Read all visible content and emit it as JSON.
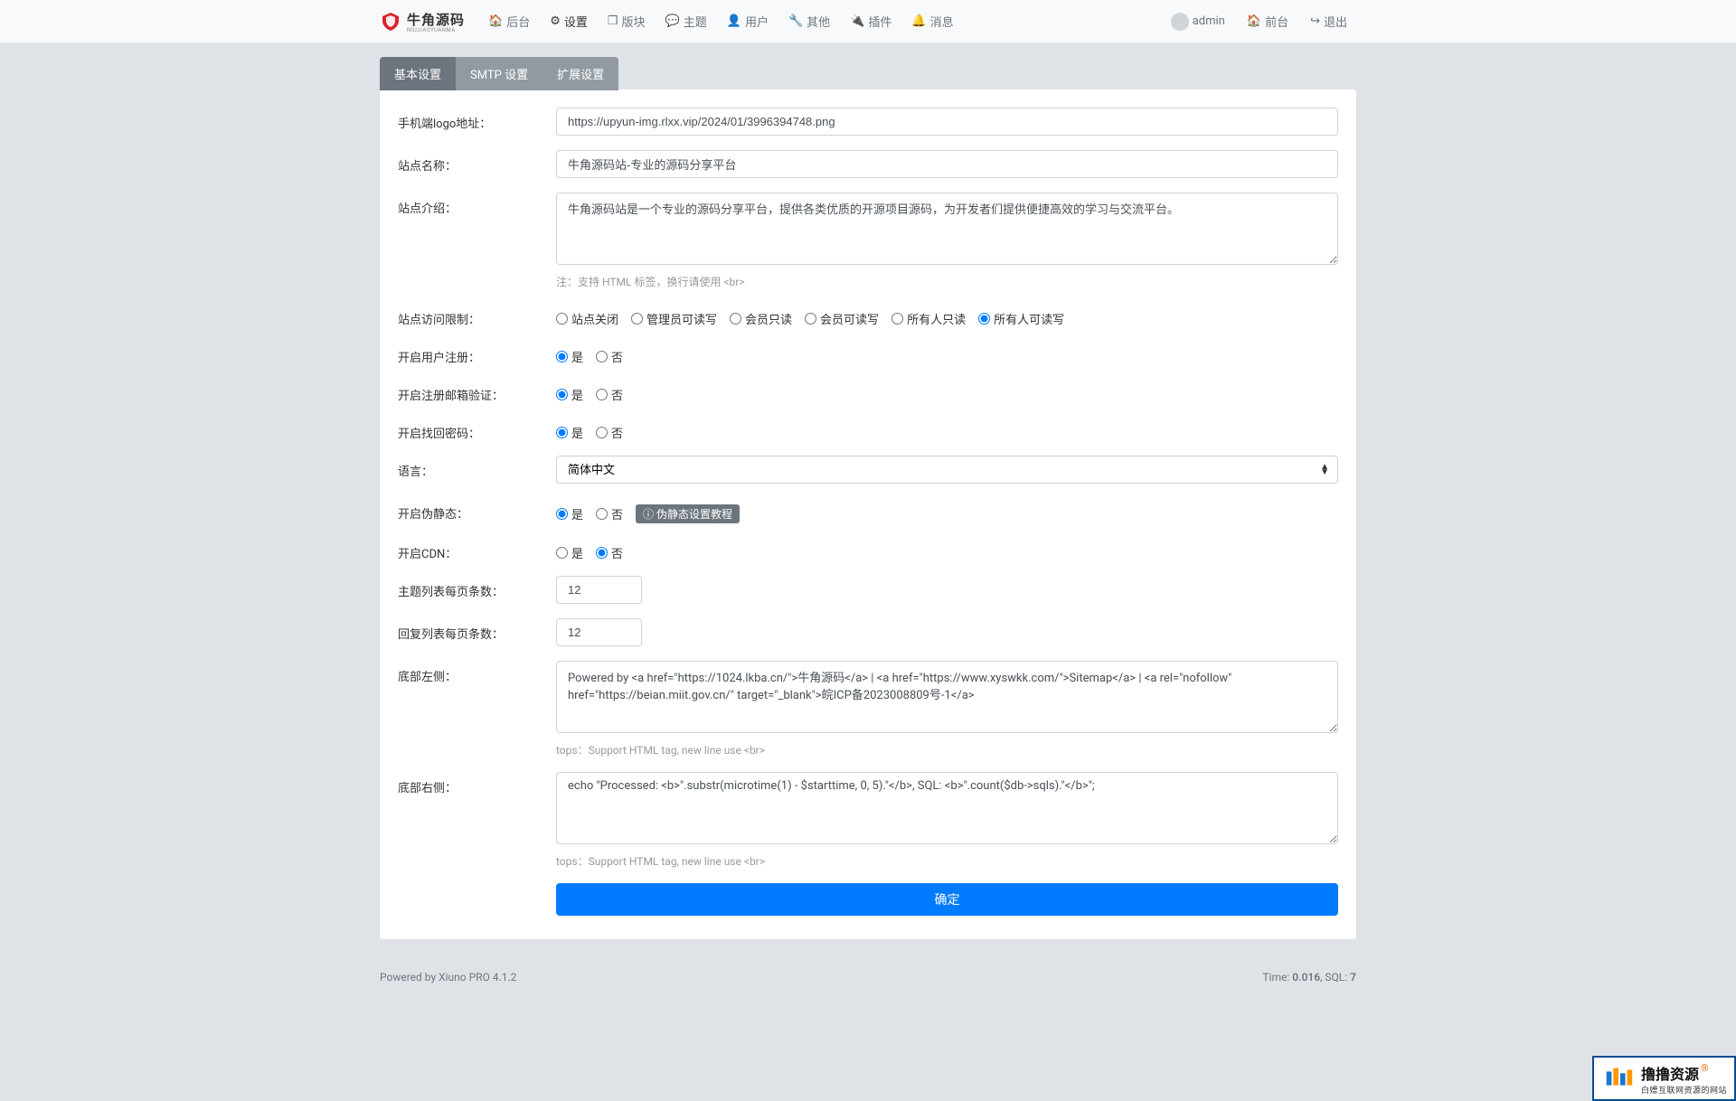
{
  "topbar": {
    "logo_text": "牛角源码",
    "logo_sub": "NIUJIAOYUANMA",
    "nav": [
      {
        "icon": "home",
        "label": "后台"
      },
      {
        "icon": "gear",
        "label": "设置"
      },
      {
        "icon": "cube",
        "label": "版块"
      },
      {
        "icon": "comment",
        "label": "主题"
      },
      {
        "icon": "user",
        "label": "用户"
      },
      {
        "icon": "wrench",
        "label": "其他"
      },
      {
        "icon": "plug",
        "label": "插件"
      },
      {
        "icon": "bell",
        "label": "消息"
      }
    ],
    "right": {
      "user": "admin",
      "frontend": "前台",
      "logout": "退出"
    }
  },
  "tabs": [
    {
      "label": "基本设置",
      "active": true
    },
    {
      "label": "SMTP 设置",
      "active": false
    },
    {
      "label": "扩展设置",
      "active": false
    }
  ],
  "form": {
    "mobile_logo": {
      "label": "手机端logo地址：",
      "value": "https://upyun-img.rlxx.vip/2024/01/3996394748.png"
    },
    "site_name": {
      "label": "站点名称：",
      "value": "牛角源码站-专业的源码分享平台"
    },
    "site_desc": {
      "label": "站点介绍：",
      "value": "牛角源码站是一个专业的源码分享平台，提供各类优质的开源项目源码，为开发者们提供便捷高效的学习与交流平台。",
      "note": "注：支持 HTML 标签，换行请使用 <br>"
    },
    "access": {
      "label": "站点访问限制：",
      "options": [
        "站点关闭",
        "管理员可读写",
        "会员只读",
        "会员可读写",
        "所有人只读",
        "所有人可读写"
      ],
      "selected": 5
    },
    "user_reg": {
      "label": "开启用户注册：",
      "options": [
        "是",
        "否"
      ],
      "selected": 0
    },
    "email_verify": {
      "label": "开启注册邮箱验证：",
      "options": [
        "是",
        "否"
      ],
      "selected": 0
    },
    "find_pwd": {
      "label": "开启找回密码：",
      "options": [
        "是",
        "否"
      ],
      "selected": 0
    },
    "language": {
      "label": "语言：",
      "value": "简体中文"
    },
    "pseudo_static": {
      "label": "开启伪静态：",
      "options": [
        "是",
        "否"
      ],
      "selected": 0,
      "badge": "伪静态设置教程"
    },
    "cdn": {
      "label": "开启CDN：",
      "options": [
        "是",
        "否"
      ],
      "selected": 1
    },
    "topics_per_page": {
      "label": "主题列表每页条数：",
      "value": "12"
    },
    "replies_per_page": {
      "label": "回复列表每页条数：",
      "value": "12"
    },
    "footer_left": {
      "label": "底部左侧：",
      "value": "Powered by <a href=\"https://1024.lkba.cn/\">牛角源码</a> | <a href=\"https://www.xyswkk.com/\">Sitemap</a> | <a rel=\"nofollow\" href=\"https://beian.miit.gov.cn/\" target=\"_blank\">皖ICP备2023008809号-1</a>",
      "note": "tops：Support HTML tag, new line use <br>"
    },
    "footer_right": {
      "label": "底部右侧：",
      "value": "echo \"Processed: <b>\".substr(microtime(1) - $starttime, 0, 5).\"</b>, SQL: <b>\".count($db->sqls).\"</b>\";",
      "note": "tops：Support HTML tag, new line use <br>"
    },
    "submit": "确定"
  },
  "footer": {
    "powered_prefix": "Powered by ",
    "powered_link": "Xiuno PRO 4.1.2",
    "time_prefix": "Time: ",
    "time_value": "0.016",
    "sql_prefix": ", SQL: ",
    "sql_value": "7"
  },
  "watermark": {
    "title": "撸撸资源",
    "sub": "白嫖互联网资源的网站"
  }
}
